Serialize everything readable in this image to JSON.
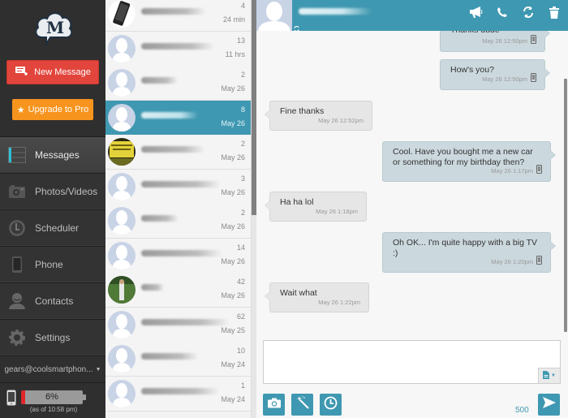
{
  "sidebar": {
    "logo_letter": "M",
    "new_message_label": "New Message",
    "upgrade_label": "Upgrade to Pro",
    "nav": [
      {
        "label": "Messages",
        "icon": "messages-icon",
        "active": true
      },
      {
        "label": "Photos/Videos",
        "icon": "camera-icon",
        "active": false
      },
      {
        "label": "Scheduler",
        "icon": "clock-icon",
        "active": false
      },
      {
        "label": "Phone",
        "icon": "phone-icon",
        "active": false
      },
      {
        "label": "Contacts",
        "icon": "contact-icon",
        "active": false
      },
      {
        "label": "Settings",
        "icon": "gear-icon",
        "active": false
      }
    ],
    "account": "gears@coolsmartphon...",
    "battery": {
      "percent_label": "6%",
      "percent": 6,
      "as_of": "(as of 10:58 pm)",
      "color": "#e0262b"
    }
  },
  "conversations": [
    {
      "count": "4",
      "time": "24 min",
      "avatar": "phone-photo",
      "active": false
    },
    {
      "count": "13",
      "time": "11 hrs",
      "avatar": "default",
      "active": false
    },
    {
      "count": "2",
      "time": "May 26",
      "avatar": "default",
      "active": false
    },
    {
      "count": "8",
      "time": "May 26",
      "avatar": "default",
      "active": true
    },
    {
      "count": "2",
      "time": "May 26",
      "avatar": "yellow-sign-photo",
      "active": false
    },
    {
      "count": "3",
      "time": "May 26",
      "avatar": "default",
      "active": false
    },
    {
      "count": "2",
      "time": "May 26",
      "avatar": "default",
      "active": false
    },
    {
      "count": "14",
      "time": "May 26",
      "avatar": "default",
      "active": false
    },
    {
      "count": "42",
      "time": "May 26",
      "avatar": "person-photo",
      "active": false
    },
    {
      "count": "62",
      "time": "May 25",
      "avatar": "default",
      "active": false
    },
    {
      "count": "10",
      "time": "May 24",
      "avatar": "default",
      "active": false
    },
    {
      "count": "1",
      "time": "May 24",
      "avatar": "default",
      "active": false
    }
  ],
  "chat": {
    "header_icons": [
      "megaphone-icon",
      "call-icon",
      "refresh-icon",
      "trash-icon"
    ],
    "messages": [
      {
        "dir": "out",
        "text": "Thanks dude",
        "time": "May 26 12:50pm",
        "device": true
      },
      {
        "dir": "out",
        "text": "How's you?",
        "time": "May 26 12:50pm",
        "device": true
      },
      {
        "dir": "in",
        "text": "Fine thanks",
        "time": "May 26 12:52pm",
        "device": false
      },
      {
        "dir": "out",
        "text": "Cool. Have you bought me a new car or something for my birthday then?",
        "time": "May 26 1:17pm",
        "device": true
      },
      {
        "dir": "in",
        "text": "Ha ha lol",
        "time": "May 26 1:18pm",
        "device": false
      },
      {
        "dir": "out",
        "text": "Oh OK... I'm quite happy with a big TV :)",
        "time": "May 26 1:20pm",
        "device": true
      },
      {
        "dir": "in",
        "text": "Wait what",
        "time": "May 26 1:22pm",
        "device": false
      }
    ],
    "compose_placeholder": "",
    "char_count": "500",
    "accent": "#3f98b1"
  }
}
